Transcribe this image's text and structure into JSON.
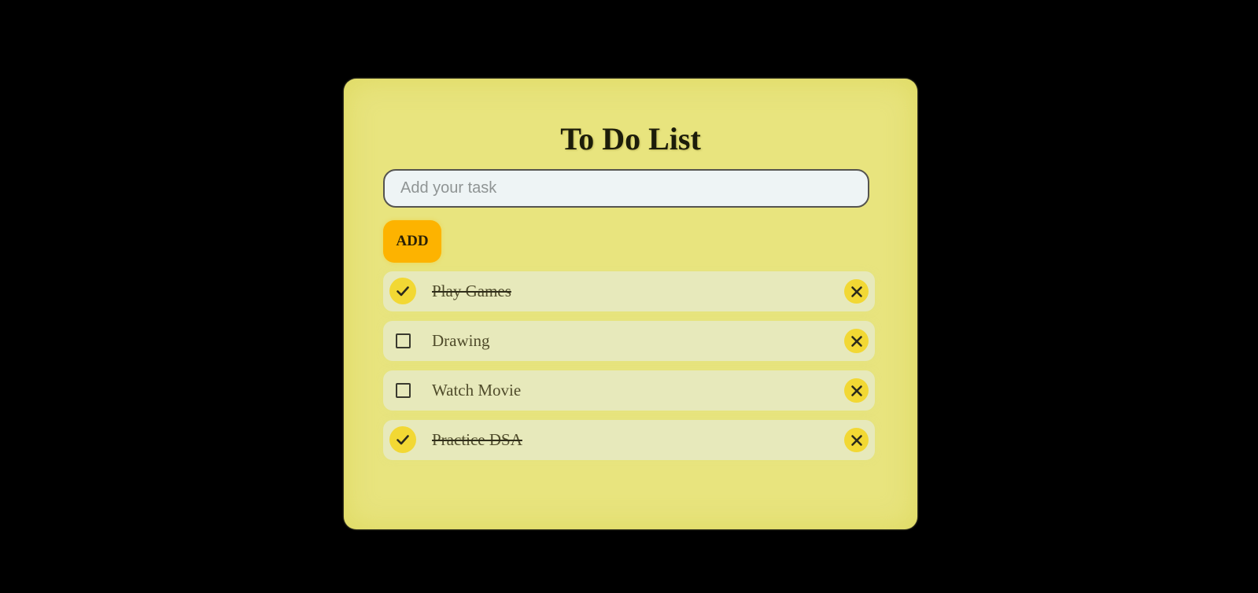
{
  "app": {
    "title": "To Do List"
  },
  "input": {
    "placeholder": "Add your task",
    "value": ""
  },
  "add_button": {
    "label": "ADD"
  },
  "tasks": [
    {
      "text": "Play Games",
      "done": true
    },
    {
      "text": "Drawing",
      "done": false
    },
    {
      "text": "Watch Movie",
      "done": false
    },
    {
      "text": "Practice DSA",
      "done": true
    }
  ],
  "icons": {
    "checked": "check-icon",
    "unchecked": "checkbox-empty-icon",
    "delete": "close-icon"
  },
  "colors": {
    "background": "#000000",
    "card": "#e8e47e",
    "add_button": "#fdb300",
    "task_row": "#e7e9bb",
    "check_circle": "#f2d834",
    "delete_circle": "#f2d834"
  }
}
